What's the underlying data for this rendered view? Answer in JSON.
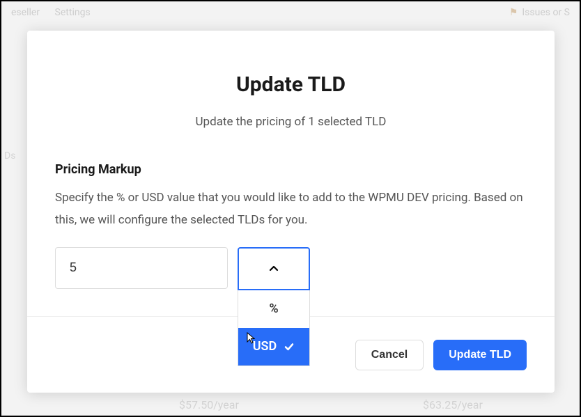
{
  "backdrop": {
    "nav": {
      "left0": "eseller",
      "left1": "Settings",
      "right_label": "Issues or S",
      "right_icon": "⚑"
    },
    "side_label": "Ds",
    "price_left": "$57.50/year",
    "price_right": "$63.25/year"
  },
  "modal": {
    "title": "Update TLD",
    "subtitle": "Update the pricing of 1 selected TLD",
    "section_heading": "Pricing Markup",
    "section_desc": "Specify the % or USD value that you would like to add to the WPMU DEV pricing. Based on this, we will configure the selected TLDs for you.",
    "markup_value": "5",
    "dropdown": {
      "open": true,
      "options": {
        "0": "%",
        "1": "USD"
      },
      "selected_index": 1
    }
  },
  "footer": {
    "cancel": "Cancel",
    "submit": "Update TLD"
  }
}
